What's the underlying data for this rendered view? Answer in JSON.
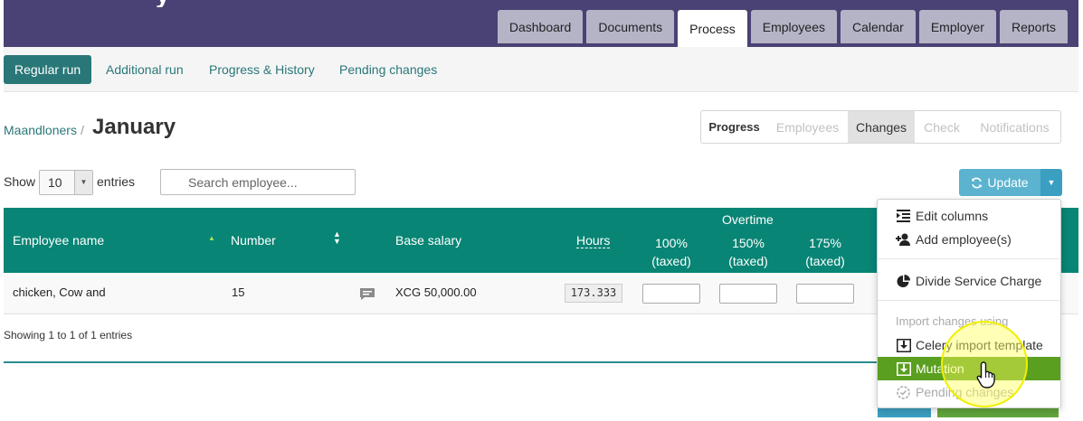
{
  "colors": {
    "topbar": "#4a4274",
    "teal": "#2a7778",
    "table_header": "#088575",
    "update_button": "#5bb3cf",
    "dropdown_active": "#5a9f1f",
    "cursor_highlight": "#ffff5a"
  },
  "nav": {
    "tabs": [
      {
        "label": "Dashboard",
        "active": false
      },
      {
        "label": "Documents",
        "active": false
      },
      {
        "label": "Process",
        "active": true
      },
      {
        "label": "Employees",
        "active": false
      },
      {
        "label": "Calendar",
        "active": false
      },
      {
        "label": "Employer",
        "active": false
      },
      {
        "label": "Reports",
        "active": false
      }
    ]
  },
  "subnav": {
    "items": [
      {
        "label": "Regular run",
        "active": true
      },
      {
        "label": "Additional run",
        "active": false
      },
      {
        "label": "Progress & History",
        "active": false
      },
      {
        "label": "Pending changes",
        "active": false
      }
    ]
  },
  "breadcrumb": {
    "parent": "Maandloners",
    "separator": "/",
    "current": "January"
  },
  "steps": [
    {
      "label": "Progress",
      "state": "bold"
    },
    {
      "label": "Employees",
      "state": "disabled"
    },
    {
      "label": "Changes",
      "state": "current"
    },
    {
      "label": "Check",
      "state": "disabled"
    },
    {
      "label": "Notifications",
      "state": "disabled"
    }
  ],
  "table_controls": {
    "show_label": "Show",
    "page_size": "10",
    "entries_label": "entries",
    "search_placeholder": "Search employee..."
  },
  "update_button": {
    "label": "Update",
    "icon": "refresh-icon"
  },
  "table": {
    "headers": {
      "employee_name": "Employee name",
      "number": "Number",
      "base_salary": "Base salary",
      "hours": "Hours",
      "overtime": "Overtime",
      "ot_100_line1": "100%",
      "ot_100_line2": "(taxed)",
      "ot_150_line1": "150%",
      "ot_150_line2": "(taxed)",
      "ot_175_line1": "175%",
      "ot_175_line2": "(taxed)"
    },
    "rows": [
      {
        "employee_name": "chicken, Cow and",
        "number": "15",
        "base_salary": "XCG 50,000.00",
        "hours": "173.333"
      }
    ]
  },
  "footer": {
    "showing": "Showing 1 to 1 of 1 entries"
  },
  "dropdown": {
    "edit_columns": "Edit columns",
    "add_employees": "Add employee(s)",
    "divide_service_charge": "Divide Service Charge",
    "import_header": "Import changes using",
    "celery_import": "Celery import template",
    "mutation": "Mutation",
    "pending_changes": "Pending changes"
  }
}
